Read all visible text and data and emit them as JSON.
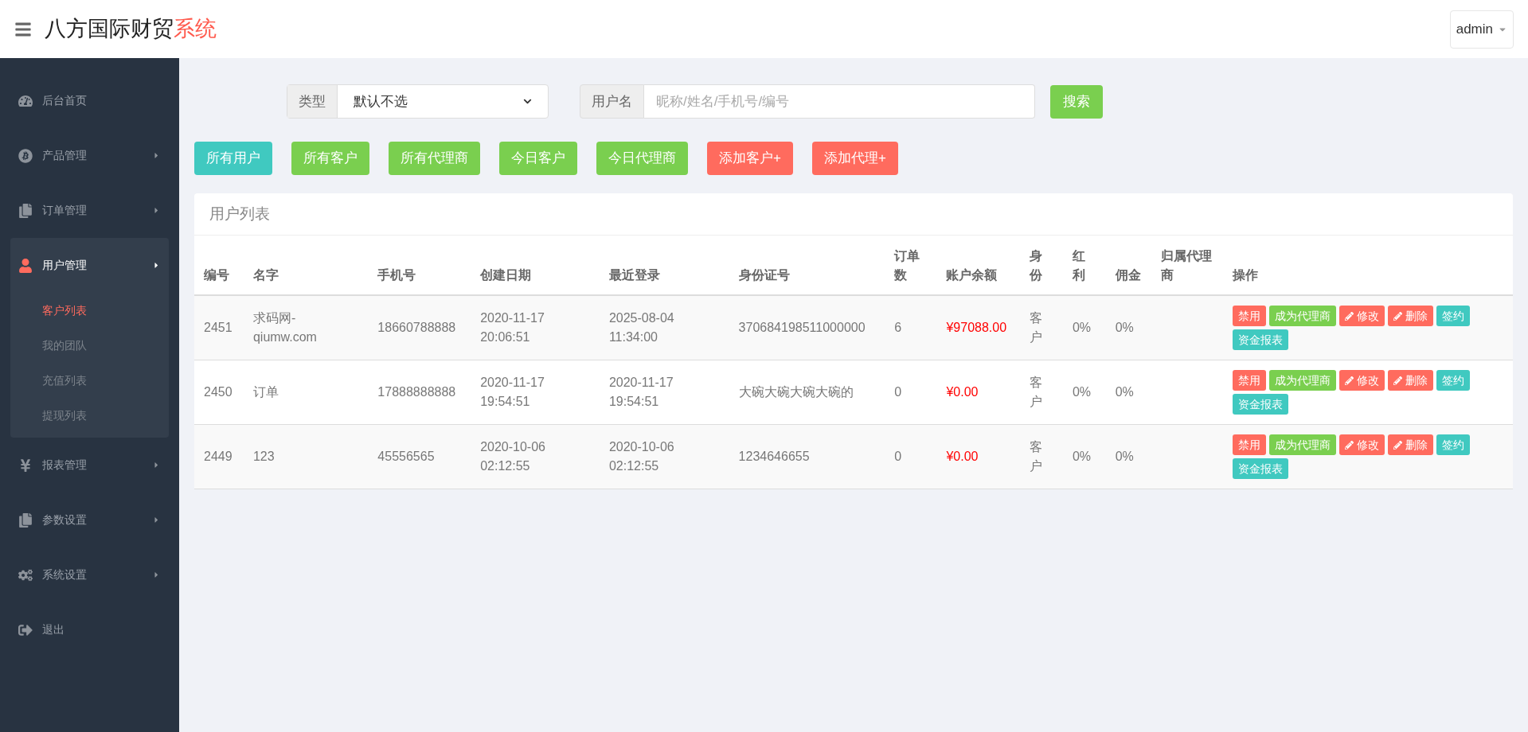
{
  "header": {
    "title": "八方国际财贸",
    "title_accent": "系统",
    "user": "admin"
  },
  "sidebar": {
    "items": [
      {
        "label": "后台首页",
        "arrow": false,
        "selected": false
      },
      {
        "label": "产品管理",
        "arrow": true,
        "selected": false
      },
      {
        "label": "订单管理",
        "arrow": true,
        "selected": false
      },
      {
        "label": "用户管理",
        "arrow": true,
        "selected": true,
        "children": [
          {
            "label": "客户列表",
            "selected": true
          },
          {
            "label": "我的团队",
            "selected": false
          },
          {
            "label": "充值列表",
            "selected": false
          },
          {
            "label": "提现列表",
            "selected": false
          }
        ]
      },
      {
        "label": "报表管理",
        "arrow": true,
        "selected": false
      },
      {
        "label": "参数设置",
        "arrow": true,
        "selected": false
      },
      {
        "label": "系统设置",
        "arrow": true,
        "selected": false
      },
      {
        "label": "退出",
        "arrow": false,
        "selected": false
      }
    ]
  },
  "filters": {
    "type_label": "类型",
    "type_value": "默认不选",
    "user_label": "用户名",
    "user_placeholder": "昵称/姓名/手机号/编号",
    "search_button": "搜索"
  },
  "quick_buttons": [
    {
      "label": "所有用户",
      "kind": "info"
    },
    {
      "label": "所有客户",
      "kind": "success"
    },
    {
      "label": "所有代理商",
      "kind": "success"
    },
    {
      "label": "今日客户",
      "kind": "success"
    },
    {
      "label": "今日代理商",
      "kind": "success"
    },
    {
      "label": "添加客户+",
      "kind": "danger"
    },
    {
      "label": "添加代理+",
      "kind": "danger"
    }
  ],
  "table": {
    "title": "用户列表",
    "columns": [
      "编号",
      "名字",
      "手机号",
      "创建日期",
      "最近登录",
      "身份证号",
      "订单数",
      "账户余额",
      "身份",
      "红利",
      "佣金",
      "归属代理商",
      "操作"
    ],
    "rows": [
      {
        "cells": [
          "2451",
          "求码网-qiumw.com",
          "18660788888",
          "2020-11-17 20:06:51",
          "2025-08-04 11:34:00",
          "370684198511000000",
          "6",
          "¥97088.00",
          "客户",
          "0%",
          "0%",
          ""
        ],
        "actions": [
          {
            "label": "禁用",
            "kind": "disable"
          },
          {
            "label": "成为代理商",
            "kind": "promote"
          },
          {
            "label": "修改",
            "kind": "edit"
          },
          {
            "label": "删除",
            "kind": "delete"
          },
          {
            "label": "签约",
            "kind": "sign"
          },
          {
            "label": "资金报表",
            "kind": "report"
          }
        ]
      },
      {
        "cells": [
          "2450",
          "订单",
          "17888888888",
          "2020-11-17 19:54:51",
          "2020-11-17 19:54:51",
          "大碗大碗大碗大碗的",
          "0",
          "¥0.00",
          "客户",
          "0%",
          "0%",
          ""
        ],
        "actions": [
          {
            "label": "禁用",
            "kind": "disable"
          },
          {
            "label": "成为代理商",
            "kind": "promote"
          },
          {
            "label": "修改",
            "kind": "edit"
          },
          {
            "label": "删除",
            "kind": "delete"
          },
          {
            "label": "签约",
            "kind": "sign"
          },
          {
            "label": "资金报表",
            "kind": "report"
          }
        ]
      },
      {
        "cells": [
          "2449",
          "123",
          "45556565",
          "2020-10-06 02:12:55",
          "2020-10-06 02:12:55",
          "1234646655",
          "0",
          "¥0.00",
          "客户",
          "0%",
          "0%",
          ""
        ],
        "actions": [
          {
            "label": "禁用",
            "kind": "disable"
          },
          {
            "label": "成为代理商",
            "kind": "promote"
          },
          {
            "label": "修改",
            "kind": "edit"
          },
          {
            "label": "删除",
            "kind": "delete"
          },
          {
            "label": "签约",
            "kind": "sign"
          },
          {
            "label": "资金报表",
            "kind": "report"
          }
        ]
      }
    ]
  }
}
